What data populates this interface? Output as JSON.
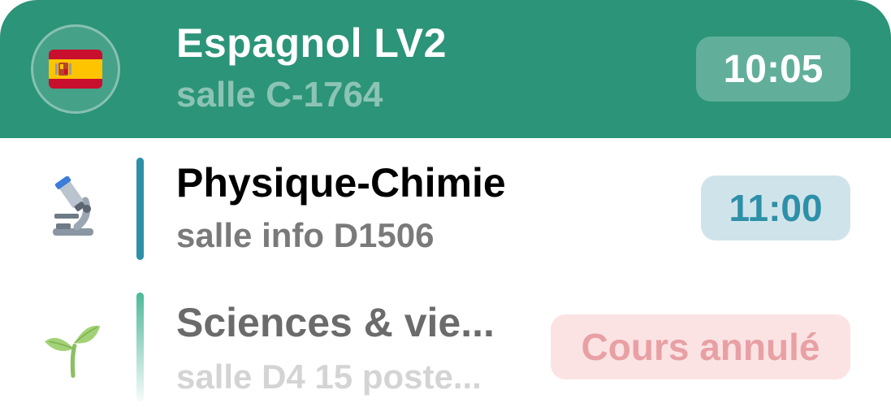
{
  "current_course": {
    "subject": "Espagnol LV2",
    "room": "salle C-1764",
    "time": "10:05",
    "icon": "spain-flag-icon",
    "color": "#2c9478"
  },
  "courses": [
    {
      "subject": "Physique-Chimie",
      "room": "salle info D1506",
      "time": "11:00",
      "icon": "microscope-icon",
      "color": "#2e8fa8",
      "cancelled": false
    },
    {
      "subject": "Sciences & vie...",
      "room": "salle D4 15 poste...",
      "status": "Cours annulé",
      "icon": "seedling-icon",
      "color": "#4cb89a",
      "cancelled": true
    }
  ]
}
